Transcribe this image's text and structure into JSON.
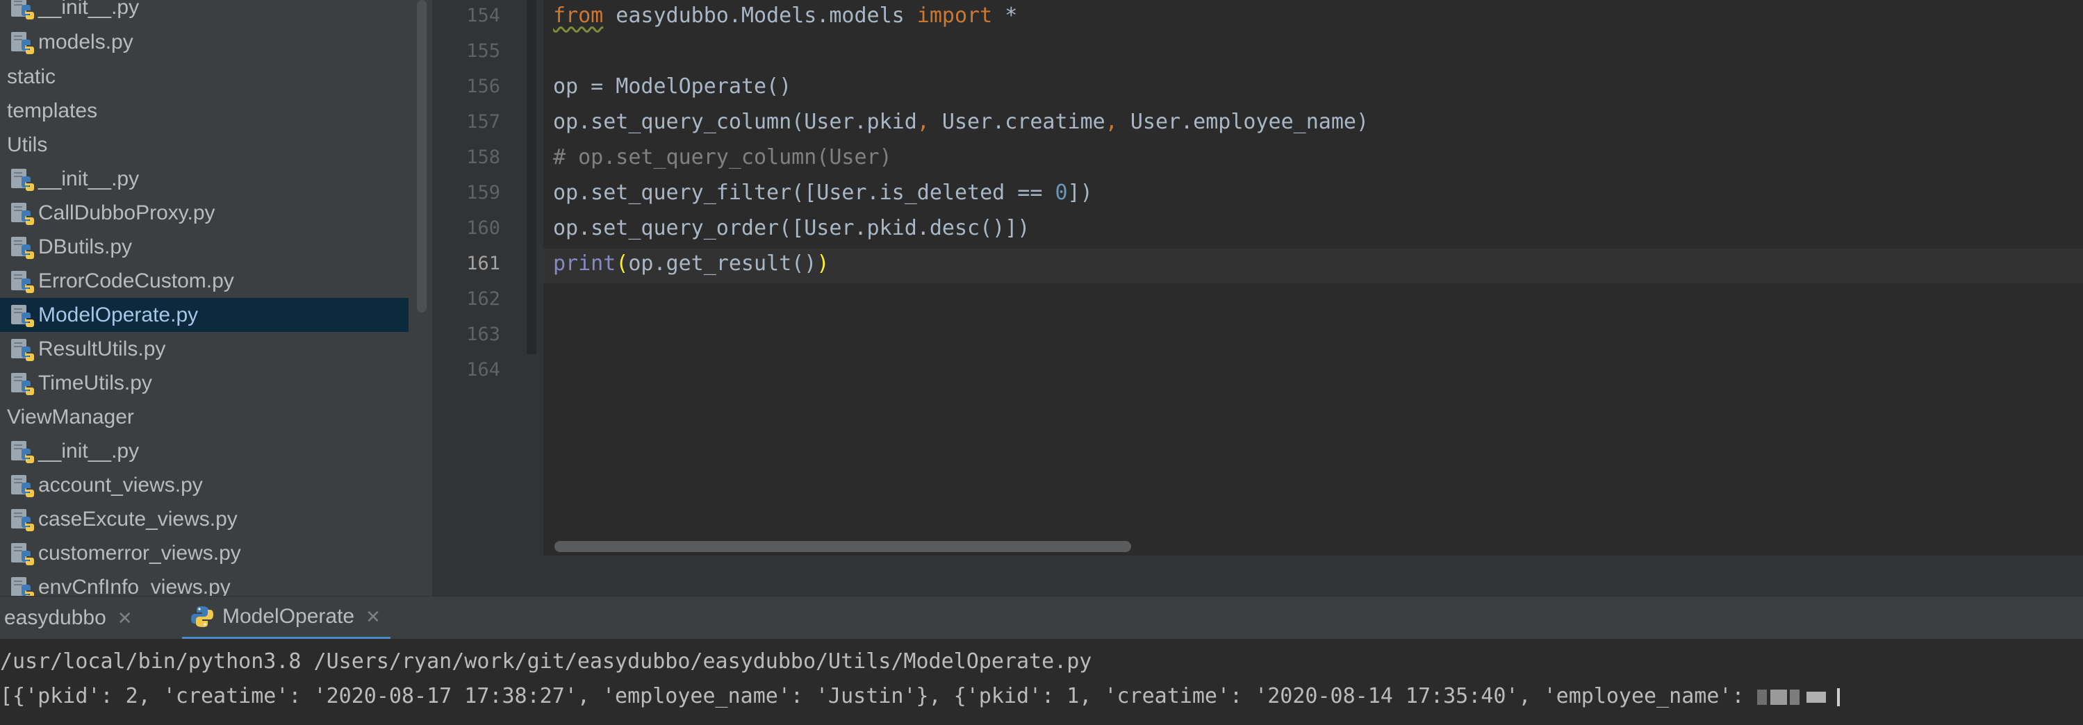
{
  "project_tree": {
    "items": [
      {
        "label": "__init__.py",
        "kind": "py"
      },
      {
        "label": "models.py",
        "kind": "py"
      },
      {
        "label": "static",
        "kind": "folder"
      },
      {
        "label": "templates",
        "kind": "folder"
      },
      {
        "label": "Utils",
        "kind": "folder"
      },
      {
        "label": "__init__.py",
        "kind": "py"
      },
      {
        "label": "CallDubboProxy.py",
        "kind": "py"
      },
      {
        "label": "DButils.py",
        "kind": "py"
      },
      {
        "label": "ErrorCodeCustom.py",
        "kind": "py"
      },
      {
        "label": "ModelOperate.py",
        "kind": "py",
        "selected": true
      },
      {
        "label": "ResultUtils.py",
        "kind": "py"
      },
      {
        "label": "TimeUtils.py",
        "kind": "py"
      },
      {
        "label": "ViewManager",
        "kind": "folder"
      },
      {
        "label": "__init__.py",
        "kind": "py"
      },
      {
        "label": "account_views.py",
        "kind": "py"
      },
      {
        "label": "caseExcute_views.py",
        "kind": "py"
      },
      {
        "label": "customerror_views.py",
        "kind": "py"
      },
      {
        "label": "envCnfInfo_views.py",
        "kind": "py"
      }
    ]
  },
  "editor": {
    "current_line": "161",
    "line_numbers": [
      "154",
      "155",
      "156",
      "157",
      "158",
      "159",
      "160",
      "161",
      "162",
      "163",
      "164"
    ],
    "lines": {
      "l154": {
        "from": "from",
        "module": " easydubbo.Models.models ",
        "import": "import",
        "star": " *"
      },
      "l156": {
        "text": "op = ModelOperate()"
      },
      "l157": {
        "a": "op.set_query_column(User.pkid",
        "c1": ",",
        "b": " User.creatime",
        "c2": ",",
        "c": " User.employee_name)"
      },
      "l158": {
        "text": "# op.set_query_column(User)"
      },
      "l159": {
        "a": "op.set_query_filter([User.is_deleted == ",
        "num": "0",
        "b": "])"
      },
      "l160": {
        "text": "op.set_query_order([User.pkid.desc()])"
      },
      "l161": {
        "print": "print",
        "open": "(",
        "mid": "op.get_result()",
        "close": ")"
      }
    }
  },
  "run_panel": {
    "tabs": [
      {
        "label": "easydubbo"
      },
      {
        "label": "ModelOperate",
        "active": true
      }
    ],
    "console": {
      "command": "/usr/local/bin/python3.8 /Users/ryan/work/git/easydubbo/easydubbo/Utils/ModelOperate.py",
      "output": "[{'pkid': 2, 'creatime': '2020-08-17 17:38:27', 'employee_name': 'Justin'}, {'pkid': 1, 'creatime': '2020-08-14 17:35:40', 'employee_name': "
    }
  },
  "colors": {
    "keyword": "#cc7832",
    "comment": "#808080",
    "number": "#6897bb",
    "builtin": "#8888c6",
    "selection": "#0d293e",
    "tab_underline": "#4a88c7"
  },
  "icons": {
    "python_file": "python-file-icon",
    "python_tab": "python-logo-icon",
    "close": "close-icon"
  }
}
